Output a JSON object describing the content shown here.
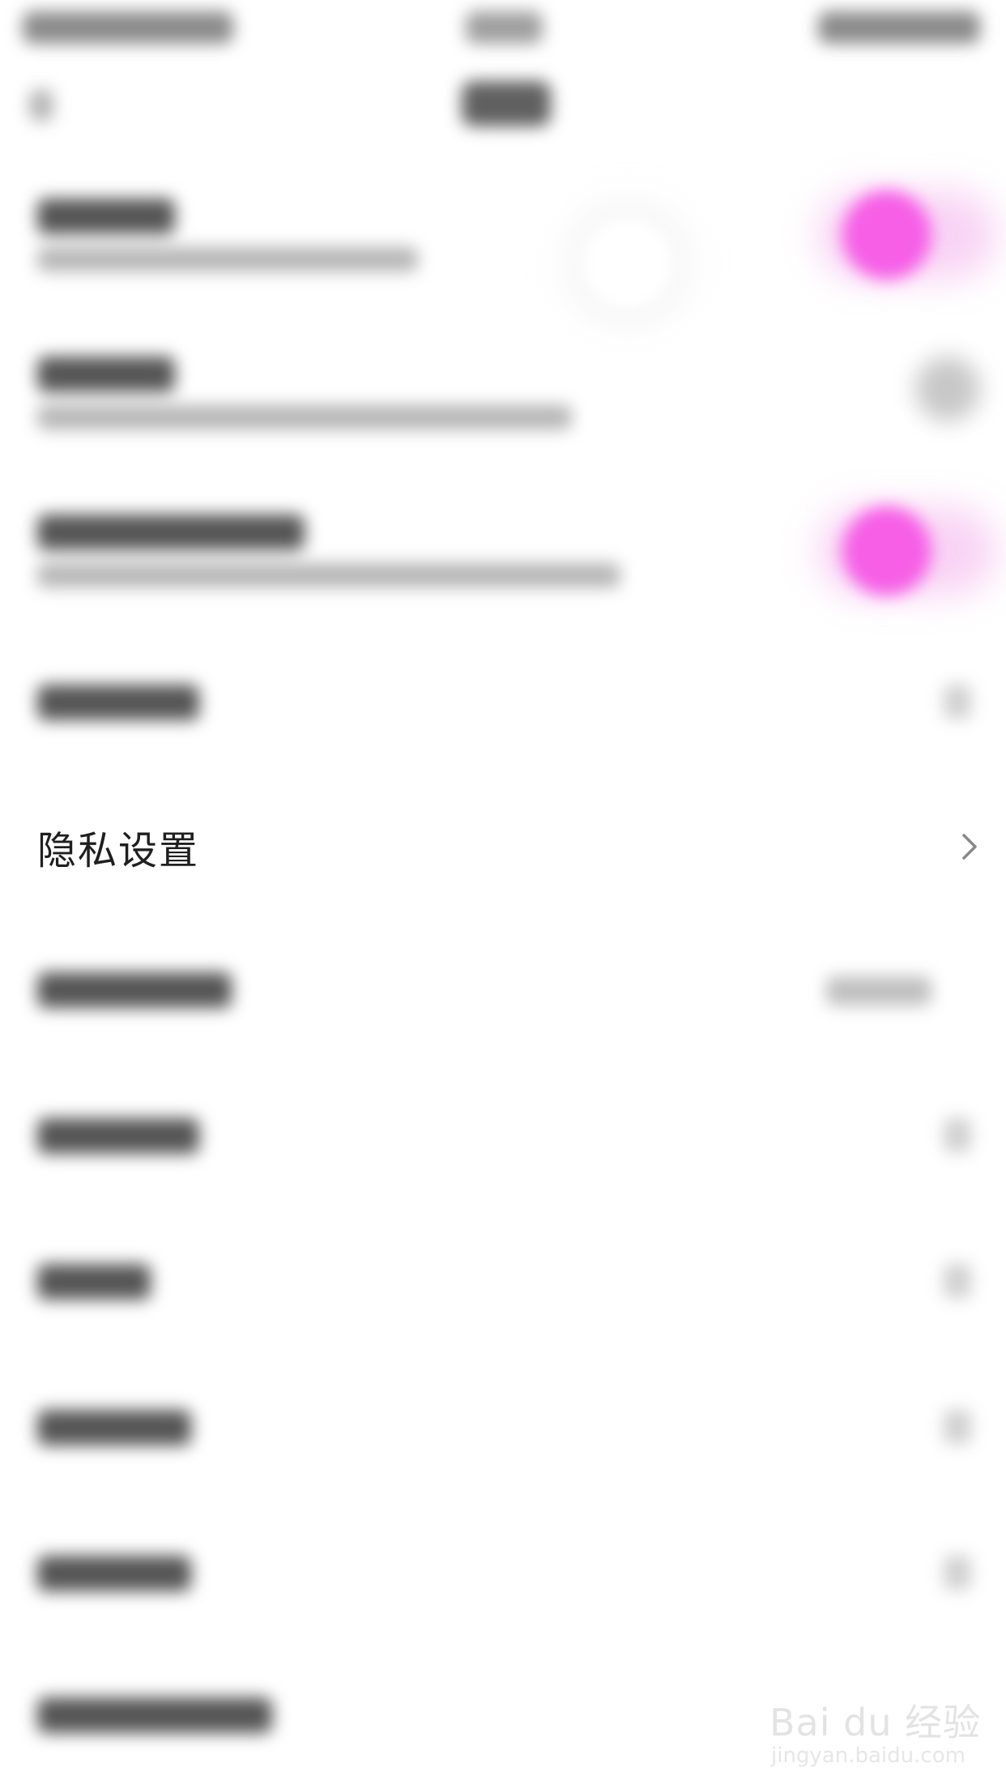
{
  "colors": {
    "accent": "#f65fe6",
    "text": "#1f1f1f",
    "chevron": "#888888",
    "background": "#ffffff"
  },
  "settings": {
    "privacy_settings": {
      "label": "隐私设置",
      "icon": "chevron-right-icon"
    }
  },
  "toggles": {
    "row1": "on",
    "row2": "off",
    "row3": "on"
  },
  "watermark": {
    "main": "Bai du 经验",
    "sub": "jingyan.baidu.com"
  }
}
